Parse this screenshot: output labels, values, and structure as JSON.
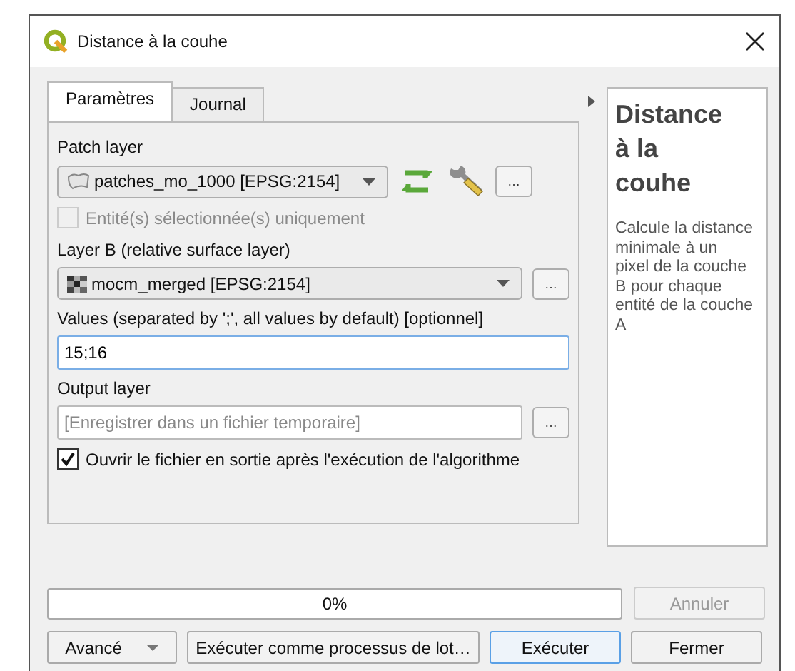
{
  "window": {
    "title": "Distance à la couhe"
  },
  "tabs": [
    {
      "label": "Paramètres",
      "selected": true
    },
    {
      "label": "Journal",
      "selected": false
    }
  ],
  "parameters": [
    {
      "kind": "vector",
      "label": "Patch layer",
      "value": "patches_mo_1000 [EPSG:2154]",
      "tools": true,
      "button": "…"
    },
    {
      "kind": "checkbox",
      "label": "Entité(s) sélectionnée(s) uniquement",
      "checked": false,
      "disabled": true
    },
    {
      "kind": "raster",
      "label": "Layer B (relative surface layer)",
      "value": "mocm_merged [EPSG:2154]",
      "tools": false,
      "button": "…"
    },
    {
      "kind": "text",
      "label": "Values (separated by ';', all values by default) [optionnel]",
      "value": "15;16"
    },
    {
      "kind": "output",
      "label": "Output layer",
      "placeholder": "[Enregistrer dans un fichier temporaire]",
      "button": "…"
    },
    {
      "kind": "checkbox",
      "label": "Ouvrir le fichier en sortie après l'exécution de l'algorithme",
      "checked": true,
      "disabled": false
    }
  ],
  "help": {
    "title": "Distance à la couhe",
    "text": "Calcule la distance minimale à un pixel de la couche B pour chaque entité de la couche A"
  },
  "progress": {
    "level": 0,
    "reading": "0%"
  },
  "cancel_button": {
    "label": "Annuler",
    "disabled": true
  },
  "buttons": [
    {
      "label": "Avancé",
      "kind": "menu"
    },
    {
      "label": "Exécuter comme processus de lot…",
      "kind": "plain"
    },
    {
      "label": "Exécuter",
      "kind": "default"
    },
    {
      "label": "Fermer",
      "kind": "plain"
    }
  ]
}
